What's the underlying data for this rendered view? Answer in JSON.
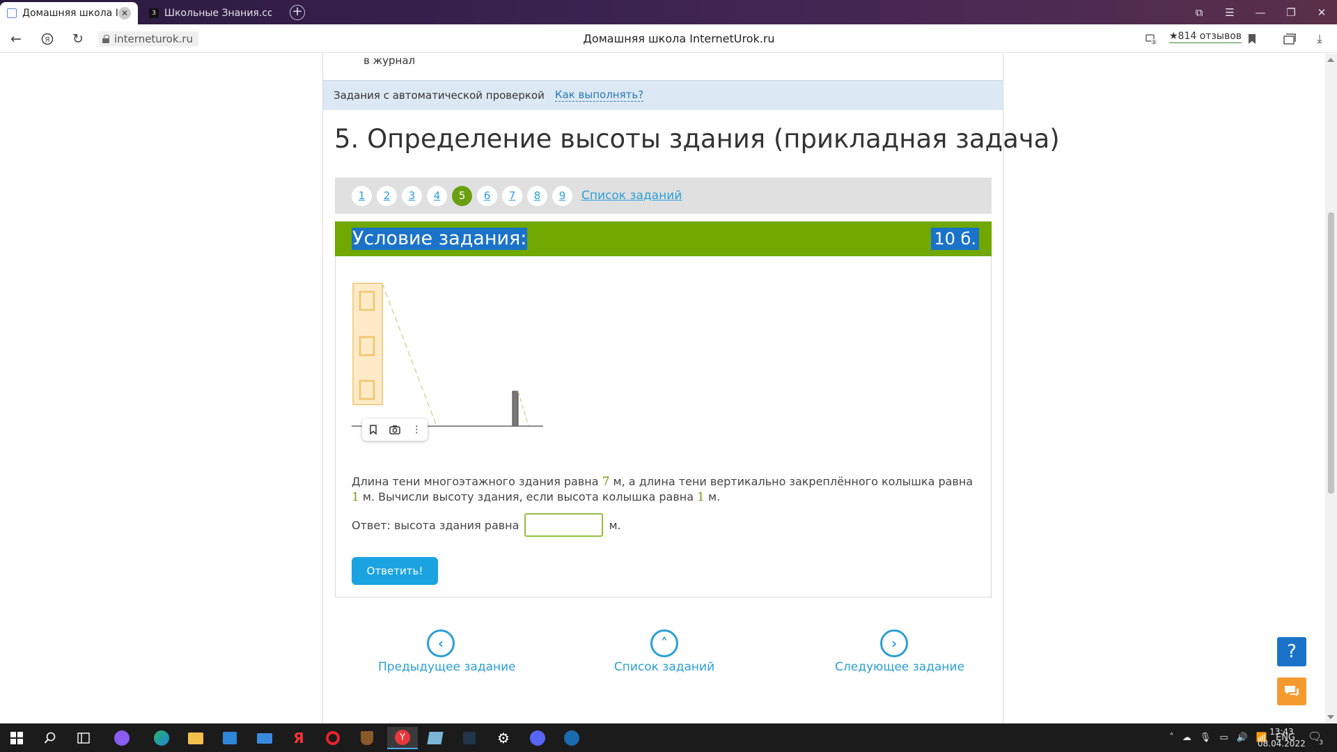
{
  "browser": {
    "tabs": [
      {
        "title": "Домашняя школа Inter",
        "active": true
      },
      {
        "title": "Школьные Знания.com - Г",
        "active": false
      }
    ],
    "url": "interneturok.ru",
    "page_title": "Домашняя школа InternetUrok.ru",
    "reviews": "★814 отзывов",
    "tab_badge": "3",
    "newtab_icon": "+"
  },
  "page": {
    "journal_text": "в журнал",
    "auto_check_label": "Задания с автоматической проверкой",
    "how_to_link": "Как выполнять?",
    "heading": "5. Определение высоты здания (прикладная задача)",
    "pager": {
      "items": [
        "1",
        "2",
        "3",
        "4",
        "5",
        "6",
        "7",
        "8",
        "9"
      ],
      "current": "5",
      "list_link": "Список заданий"
    },
    "task": {
      "condition_title": "Условие задания:",
      "points": "10 б.",
      "text_part1": "Длина тени многоэтажного здания равна ",
      "value_shadow_building": "7",
      "text_part2": " м, а длина тени вертикально закреплённого колышка равна ",
      "value_shadow_stick": "1",
      "text_part3": " м. Вычисли высоту здания, если высота колышка равна ",
      "value_stick_height": "1",
      "text_part4": " м.",
      "answer_label": "Ответ: высота здания равна",
      "answer_unit": "м.",
      "answer_value": "",
      "submit_label": "Ответить!"
    },
    "nav": {
      "prev": "Предыдущее задание",
      "list": "Список заданий",
      "next": "Следующее задание"
    },
    "help_label": "?"
  },
  "taskbar": {
    "lang": "ENG",
    "time": "13:43",
    "date": "08.04.2022",
    "notifications": "3"
  },
  "colors": {
    "accent_green": "#70a800",
    "link_blue": "#2a9fd6",
    "selection_blue": "#1a73c8",
    "button_blue": "#1aa3e0"
  }
}
